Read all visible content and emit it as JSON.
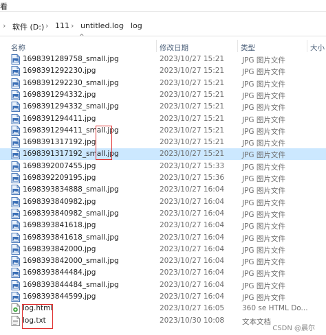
{
  "top_fragment": "看",
  "address": {
    "segments": [
      "软件 (D:)",
      "111",
      "untitled.log",
      "log"
    ]
  },
  "columns": {
    "name": "名称",
    "date": "修改日期",
    "type": "类型",
    "size": "大小"
  },
  "files": [
    {
      "name": "1698391289758_small.jpg",
      "date": "2023/10/27 15:21",
      "type": "JPG 图片文件",
      "icon": "jpg-image-icon",
      "selected": false
    },
    {
      "name": "1698391292230.jpg",
      "date": "2023/10/27 15:21",
      "type": "JPG 图片文件",
      "icon": "jpg-image-icon",
      "selected": false
    },
    {
      "name": "1698391292230_small.jpg",
      "date": "2023/10/27 15:21",
      "type": "JPG 图片文件",
      "icon": "jpg-image-icon",
      "selected": false
    },
    {
      "name": "1698391294332.jpg",
      "date": "2023/10/27 15:21",
      "type": "JPG 图片文件",
      "icon": "jpg-image-icon",
      "selected": false
    },
    {
      "name": "1698391294332_small.jpg",
      "date": "2023/10/27 15:21",
      "type": "JPG 图片文件",
      "icon": "jpg-image-icon",
      "selected": false
    },
    {
      "name": "1698391294411.jpg",
      "date": "2023/10/27 15:21",
      "type": "JPG 图片文件",
      "icon": "jpg-image-icon",
      "selected": false
    },
    {
      "name": "1698391294411_small.jpg",
      "date": "2023/10/27 15:21",
      "type": "JPG 图片文件",
      "icon": "jpg-image-icon",
      "selected": false
    },
    {
      "name": "1698391317192.jpg",
      "date": "2023/10/27 15:21",
      "type": "JPG 图片文件",
      "icon": "jpg-image-icon",
      "selected": false
    },
    {
      "name": "1698391317192_small.jpg",
      "date": "2023/10/27 15:21",
      "type": "JPG 图片文件",
      "icon": "jpg-image-icon",
      "selected": true
    },
    {
      "name": "1698392007455.jpg",
      "date": "2023/10/27 15:33",
      "type": "JPG 图片文件",
      "icon": "jpg-image-icon",
      "selected": false
    },
    {
      "name": "1698392209195.jpg",
      "date": "2023/10/27 15:36",
      "type": "JPG 图片文件",
      "icon": "jpg-image-icon",
      "selected": false
    },
    {
      "name": "1698393834888_small.jpg",
      "date": "2023/10/27 16:04",
      "type": "JPG 图片文件",
      "icon": "jpg-image-icon",
      "selected": false
    },
    {
      "name": "1698393840982.jpg",
      "date": "2023/10/27 16:04",
      "type": "JPG 图片文件",
      "icon": "jpg-image-icon",
      "selected": false
    },
    {
      "name": "1698393840982_small.jpg",
      "date": "2023/10/27 16:04",
      "type": "JPG 图片文件",
      "icon": "jpg-image-icon",
      "selected": false
    },
    {
      "name": "1698393841618.jpg",
      "date": "2023/10/27 16:04",
      "type": "JPG 图片文件",
      "icon": "jpg-image-icon",
      "selected": false
    },
    {
      "name": "1698393841618_small.jpg",
      "date": "2023/10/27 16:04",
      "type": "JPG 图片文件",
      "icon": "jpg-image-icon",
      "selected": false
    },
    {
      "name": "1698393842000.jpg",
      "date": "2023/10/27 16:04",
      "type": "JPG 图片文件",
      "icon": "jpg-image-icon",
      "selected": false
    },
    {
      "name": "1698393842000_small.jpg",
      "date": "2023/10/27 16:04",
      "type": "JPG 图片文件",
      "icon": "jpg-image-icon",
      "selected": false
    },
    {
      "name": "1698393844484.jpg",
      "date": "2023/10/27 16:04",
      "type": "JPG 图片文件",
      "icon": "jpg-image-icon",
      "selected": false
    },
    {
      "name": "1698393844484_small.jpg",
      "date": "2023/10/27 16:04",
      "type": "JPG 图片文件",
      "icon": "jpg-image-icon",
      "selected": false
    },
    {
      "name": "1698393844599.jpg",
      "date": "2023/10/27 16:04",
      "type": "JPG 图片文件",
      "icon": "jpg-image-icon",
      "selected": false
    },
    {
      "name": "log.html",
      "date": "2023/10/27 16:05",
      "type": "360 se HTML Do...",
      "icon": "html-document-icon",
      "selected": false
    },
    {
      "name": "log.txt",
      "date": "2023/10/30 10:08",
      "type": "文本文档",
      "icon": "text-document-icon",
      "selected": false
    }
  ],
  "watermark": "CSDN @晨尔",
  "colors": {
    "selection": "#cce8ff",
    "highlight_box": "#e0302f",
    "header_text": "#4c607a"
  }
}
